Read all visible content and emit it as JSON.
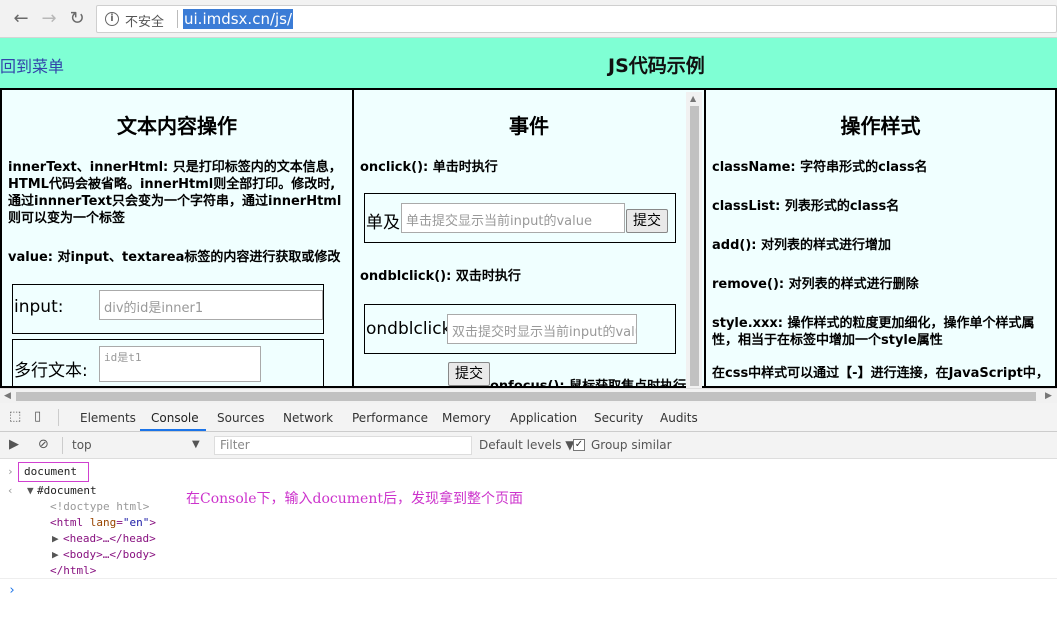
{
  "browser": {
    "security_label": "不安全",
    "url": "ui.imdsx.cn/js/"
  },
  "page": {
    "back_link": "回到菜单",
    "title": "JS代码示例",
    "panel_text": {
      "title": "文本内容操作",
      "desc1": "innerText、innerHtml: 只是打印标签内的文本信息，HTML代码会被省略。innerHtml则全部打印。修改时,通过innnerText只会变为一个字符串，通过innerHtml则可以变为一个标签",
      "desc2": "value: 对input、textarea标签的内容进行获取或修改",
      "input_label": "input:",
      "input_placeholder": "div的id是inner1",
      "textarea_label": "多行文本:",
      "textarea_placeholder": "id是t1"
    },
    "panel_events": {
      "title": "事件",
      "onclick_desc": "onclick(): 单击时执行",
      "single_label": "单及:",
      "single_placeholder": "单击提交显示当前input的value",
      "submit1": "提交",
      "ondblclick_desc": "ondblclick(): 双击时执行",
      "dbl_label": "ondblclick:",
      "dbl_placeholder": "双击提交时显示当前input的valu",
      "submit2": "提交",
      "onfocus_desc": "onfocus(): 鼠标获取焦点时执行"
    },
    "panel_style": {
      "title": "操作样式",
      "items": [
        "className: 字符串形式的class名",
        "classList: 列表形式的class名",
        "add(): 对列表的样式进行增加",
        "remove(): 对列表的样式进行删除",
        "style.xxx: 操作样式的粒度更加细化，操作单个样式属性，相当于在标签中增加一个style属性",
        "在css中样式可以通过【-】进行连接，在JavaScript中，"
      ]
    }
  },
  "devtools": {
    "tabs": [
      "Elements",
      "Console",
      "Sources",
      "Network",
      "Performance",
      "Memory",
      "Application",
      "Security",
      "Audits"
    ],
    "active_tab": "Console",
    "context": "top",
    "filter_placeholder": "Filter",
    "levels": "Default levels ▼",
    "group_similar": "Group similar",
    "group_similar_checked": true,
    "console": {
      "command": "document",
      "result_root": "#document",
      "doctype": "<!doctype html>",
      "html_open_tag": "html",
      "html_attr_name": "lang",
      "html_attr_value": "\"en\"",
      "head_node": "<head>…</head>",
      "body_node": "<body>…</body>",
      "html_close": "</html>",
      "annotation": "在Console下，输入document后，发现拿到整个页面"
    }
  }
}
